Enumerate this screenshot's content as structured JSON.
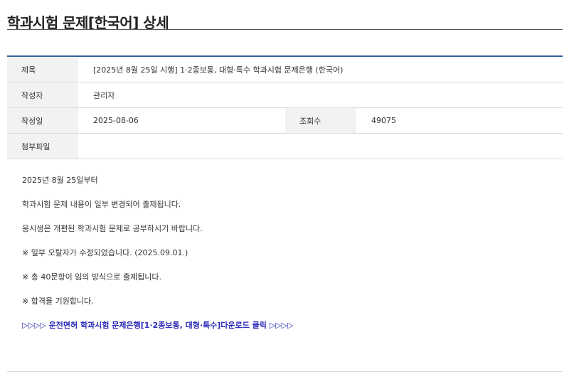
{
  "page": {
    "title": "학과시험 문제[한국어] 상세"
  },
  "detail": {
    "subject_label": "제목",
    "subject_value": "[2025년 8월 25일 시행] 1·2종보통, 대형·특수 학과시험 문제은행 (한국어)",
    "author_label": "작성자",
    "author_value": "관리자",
    "date_label": "작성일",
    "date_value": "2025-08-06",
    "views_label": "조회수",
    "views_value": "49075",
    "attachment_label": "첨부파일",
    "attachment_value": ""
  },
  "body": {
    "paragraphs": [
      "2025년 8월 25일부터",
      "학과시험 문제 내용이 일부 변경되어 출제됩니다.",
      "응시생은 개편된 학과시험 문제로 공부하시기 바랍니다.",
      "※ 일부 오탈자가 수정되었습니다. (2025.09.01.)",
      "※ 총 40문항이 임의 방식으로 출제됩니다.",
      "※ 합격을 기원합니다."
    ],
    "download_link": "▷▷▷▷ 운전면허 학과시험 문제은행[1·2종보통, 대형·특수]다운로드 클릭 ▷▷▷▷"
  },
  "colors": {
    "accent": "#2f5fa8",
    "link": "#2a2ab8",
    "header_cell_bg": "#f2f2f2"
  }
}
